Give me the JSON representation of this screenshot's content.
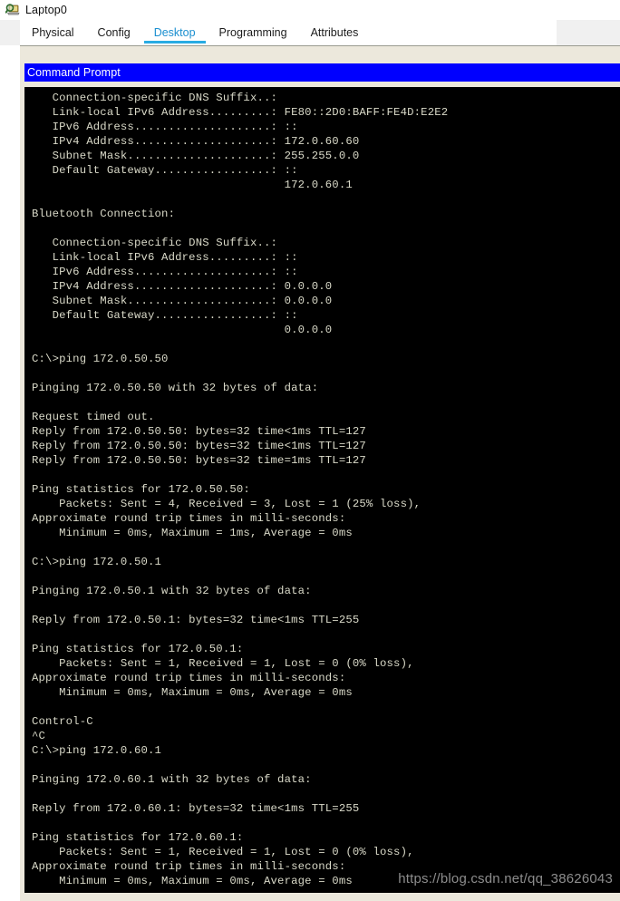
{
  "window": {
    "title": "Laptop0",
    "icon": "laptop-magnifier-icon"
  },
  "tabs": [
    {
      "label": "Physical",
      "active": false
    },
    {
      "label": "Config",
      "active": false
    },
    {
      "label": "Desktop",
      "active": true
    },
    {
      "label": "Programming",
      "active": false
    },
    {
      "label": "Attributes",
      "active": false
    }
  ],
  "command_prompt": {
    "title": "Command Prompt",
    "titlebar_color": "#0000ff",
    "background_color": "#000000",
    "text_color": "#d9d9c8",
    "output": "   Connection-specific DNS Suffix..:\n   Link-local IPv6 Address.........: FE80::2D0:BAFF:FE4D:E2E2\n   IPv6 Address....................: ::\n   IPv4 Address....................: 172.0.60.60\n   Subnet Mask.....................: 255.255.0.0\n   Default Gateway.................: ::\n                                     172.0.60.1\n\nBluetooth Connection:\n\n   Connection-specific DNS Suffix..:\n   Link-local IPv6 Address.........: ::\n   IPv6 Address....................: ::\n   IPv4 Address....................: 0.0.0.0\n   Subnet Mask.....................: 0.0.0.0\n   Default Gateway.................: ::\n                                     0.0.0.0\n\nC:\\>ping 172.0.50.50\n\nPinging 172.0.50.50 with 32 bytes of data:\n\nRequest timed out.\nReply from 172.0.50.50: bytes=32 time<1ms TTL=127\nReply from 172.0.50.50: bytes=32 time<1ms TTL=127\nReply from 172.0.50.50: bytes=32 time=1ms TTL=127\n\nPing statistics for 172.0.50.50:\n    Packets: Sent = 4, Received = 3, Lost = 1 (25% loss),\nApproximate round trip times in milli-seconds:\n    Minimum = 0ms, Maximum = 1ms, Average = 0ms\n\nC:\\>ping 172.0.50.1\n\nPinging 172.0.50.1 with 32 bytes of data:\n\nReply from 172.0.50.1: bytes=32 time<1ms TTL=255\n\nPing statistics for 172.0.50.1:\n    Packets: Sent = 1, Received = 1, Lost = 0 (0% loss),\nApproximate round trip times in milli-seconds:\n    Minimum = 0ms, Maximum = 0ms, Average = 0ms\n\nControl-C\n^C\nC:\\>ping 172.0.60.1\n\nPinging 172.0.60.1 with 32 bytes of data:\n\nReply from 172.0.60.1: bytes=32 time<1ms TTL=255\n\nPing statistics for 172.0.60.1:\n    Packets: Sent = 1, Received = 1, Lost = 0 (0% loss),\nApproximate round trip times in milli-seconds:\n    Minimum = 0ms, Maximum = 0ms, Average = 0ms"
  },
  "watermark": {
    "text": "https://blog.csdn.net/qq_38626043"
  }
}
